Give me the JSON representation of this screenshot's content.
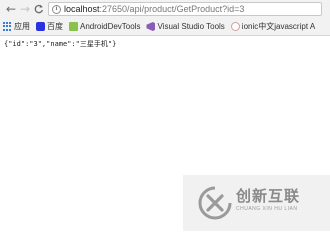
{
  "toolbar": {
    "back_glyph": "←",
    "forward_glyph": "→",
    "reload_glyph": "C",
    "address": {
      "info_glyph": "i",
      "host": "localhost",
      "rest": ":27650/api/product/GetProduct?id=3"
    }
  },
  "bookmarks": [
    {
      "label": "应用",
      "icon": "apps-grid-icon",
      "color": "#3b7bd8"
    },
    {
      "label": "百度",
      "icon": "baidu-icon",
      "color": "#2932e1"
    },
    {
      "label": "AndroidDevTools",
      "icon": "android-icon",
      "color": "#8bc34a"
    },
    {
      "label": "Visual Studio Tools",
      "icon": "visual-studio-icon",
      "color": "#8a5bb8"
    },
    {
      "label": "ionic中文javascript A",
      "icon": "ionic-icon",
      "color": "#d0a0a0"
    }
  ],
  "page": {
    "json_text": "{\"id\":\"3\",\"name\":\"三星手机\"}"
  },
  "watermark": {
    "title": "创新互联",
    "subtitle": "CHUANG XIN HU LIAN"
  }
}
